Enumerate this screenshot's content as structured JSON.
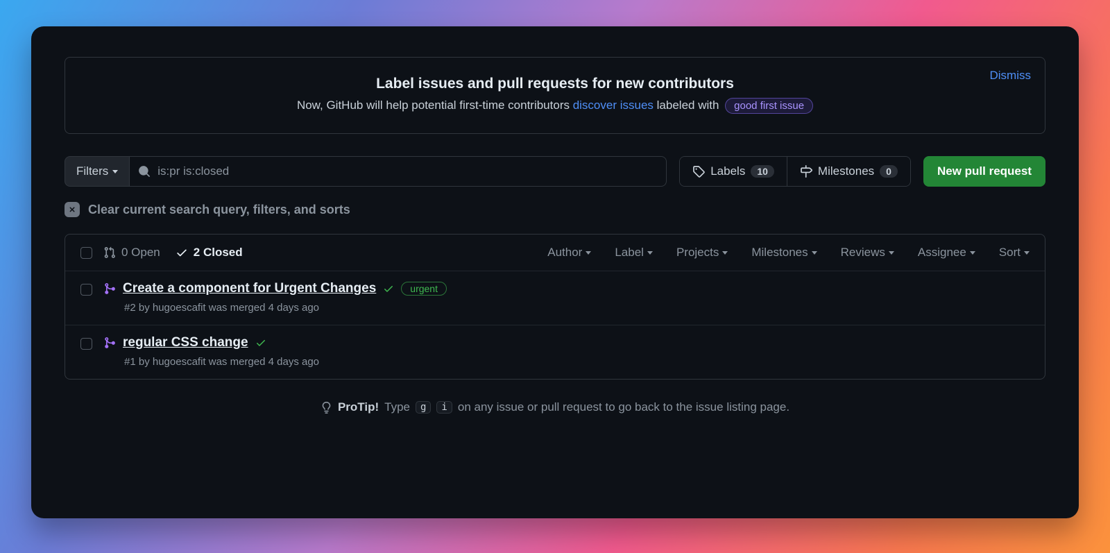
{
  "banner": {
    "title": "Label issues and pull requests for new contributors",
    "desc_pre": "Now, GitHub will help potential first-time contributors ",
    "desc_link": "discover issues",
    "desc_post": " labeled with ",
    "badge": "good first issue",
    "dismiss": "Dismiss"
  },
  "toolbar": {
    "filters_label": "Filters",
    "search_value": "is:pr is:closed",
    "labels_label": "Labels",
    "labels_count": "10",
    "milestones_label": "Milestones",
    "milestones_count": "0",
    "new_pr": "New pull request"
  },
  "clear": {
    "text": "Clear current search query, filters, and sorts"
  },
  "list_header": {
    "open": "0 Open",
    "closed": "2 Closed",
    "filters": [
      "Author",
      "Label",
      "Projects",
      "Milestones",
      "Reviews",
      "Assignee",
      "Sort"
    ]
  },
  "rows": [
    {
      "title": "Create a component for Urgent Changes",
      "label": "urgent",
      "sub": "#2 by hugoescafit was merged 4 days ago",
      "has_label": true
    },
    {
      "title": "regular CSS change",
      "label": "",
      "sub": "#1 by hugoescafit was merged 4 days ago",
      "has_label": false
    }
  ],
  "protip": {
    "lead": "ProTip!",
    "pre": "Type",
    "k1": "g",
    "k2": "i",
    "post": "on any issue or pull request to go back to the issue listing page."
  }
}
